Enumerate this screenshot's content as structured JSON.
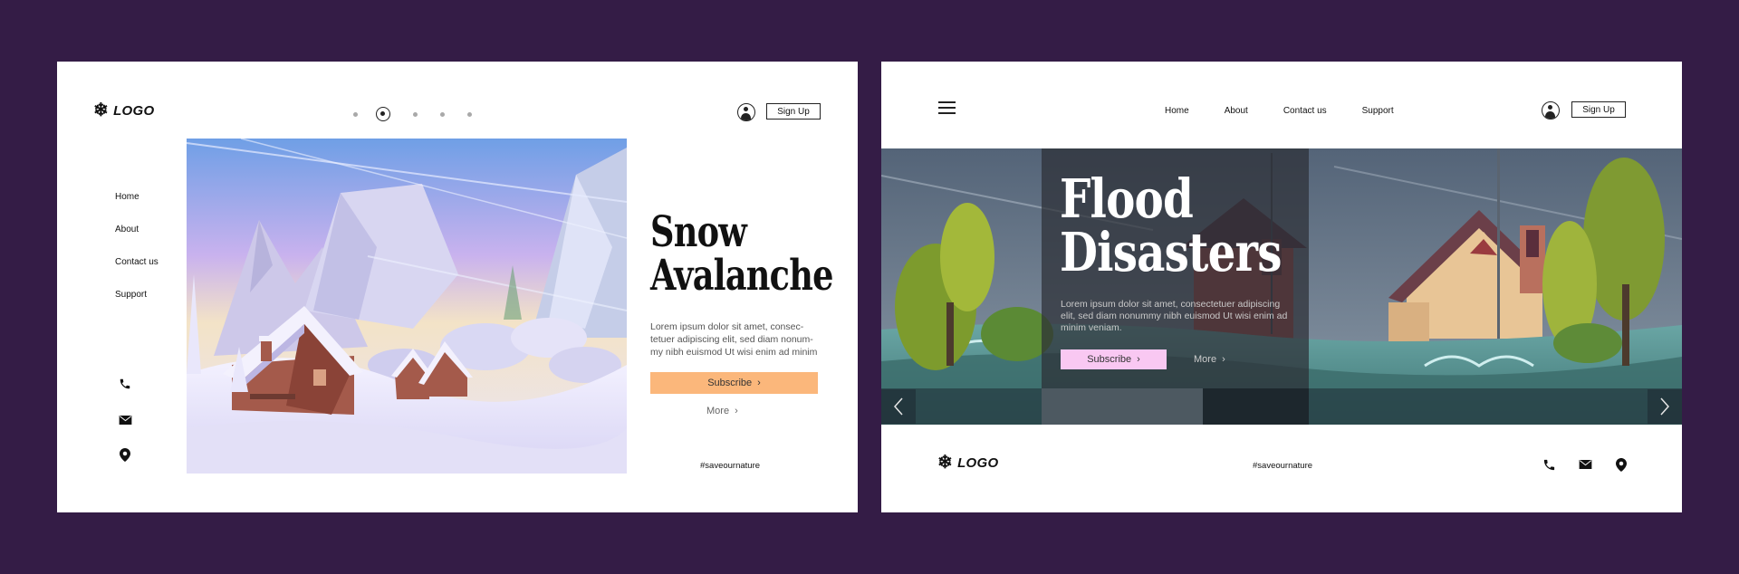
{
  "colors": {
    "background": "#341c46",
    "card": "#ffffff",
    "snow_subscribe": "#fbb77b",
    "flood_subscribe": "#f9c8f2"
  },
  "snow_page": {
    "logo": {
      "icon": "snowflake-icon",
      "text": "LOGO"
    },
    "carousel_dots": {
      "count": 5,
      "active_index": 1
    },
    "header": {
      "user_icon": "user-icon",
      "signup_label": "Sign Up"
    },
    "sidebar": {
      "items": [
        {
          "label": "Home"
        },
        {
          "label": "About"
        },
        {
          "label": "Contact us"
        },
        {
          "label": "Support"
        }
      ],
      "icons": [
        "phone-icon",
        "mail-icon",
        "location-pin-icon"
      ]
    },
    "hero": {
      "title_line1": "Snow",
      "title_line2": "Avalanche",
      "body": "Lorem ipsum dolor sit amet, consec-tetuer adipiscing elit, sed diam nonum-my nibh euismod Ut wisi enim ad minim",
      "subscribe_label": "Subscribe",
      "more_label": "More"
    },
    "hashtag": "#saveournature"
  },
  "flood_page": {
    "header": {
      "menu_icon": "hamburger-menu-icon",
      "nav": [
        {
          "label": "Home"
        },
        {
          "label": "About"
        },
        {
          "label": "Contact us"
        },
        {
          "label": "Support"
        }
      ],
      "user_icon": "user-icon",
      "signup_label": "Sign Up"
    },
    "hero": {
      "title_line1": "Flood",
      "title_line2": "Disasters",
      "body": "Lorem ipsum dolor sit amet, consectetuer adipiscing elit, sed diam nonummy nibh euismod Ut wisi enim ad minim veniam.",
      "subscribe_label": "Subscribe",
      "more_label": "More",
      "prev_icon": "chevron-left-icon",
      "next_icon": "chevron-right-icon"
    },
    "footer": {
      "logo": {
        "icon": "snowflake-icon",
        "text": "LOGO"
      },
      "hashtag": "#saveournature",
      "icons": [
        "phone-icon",
        "mail-icon",
        "location-pin-icon"
      ]
    }
  }
}
